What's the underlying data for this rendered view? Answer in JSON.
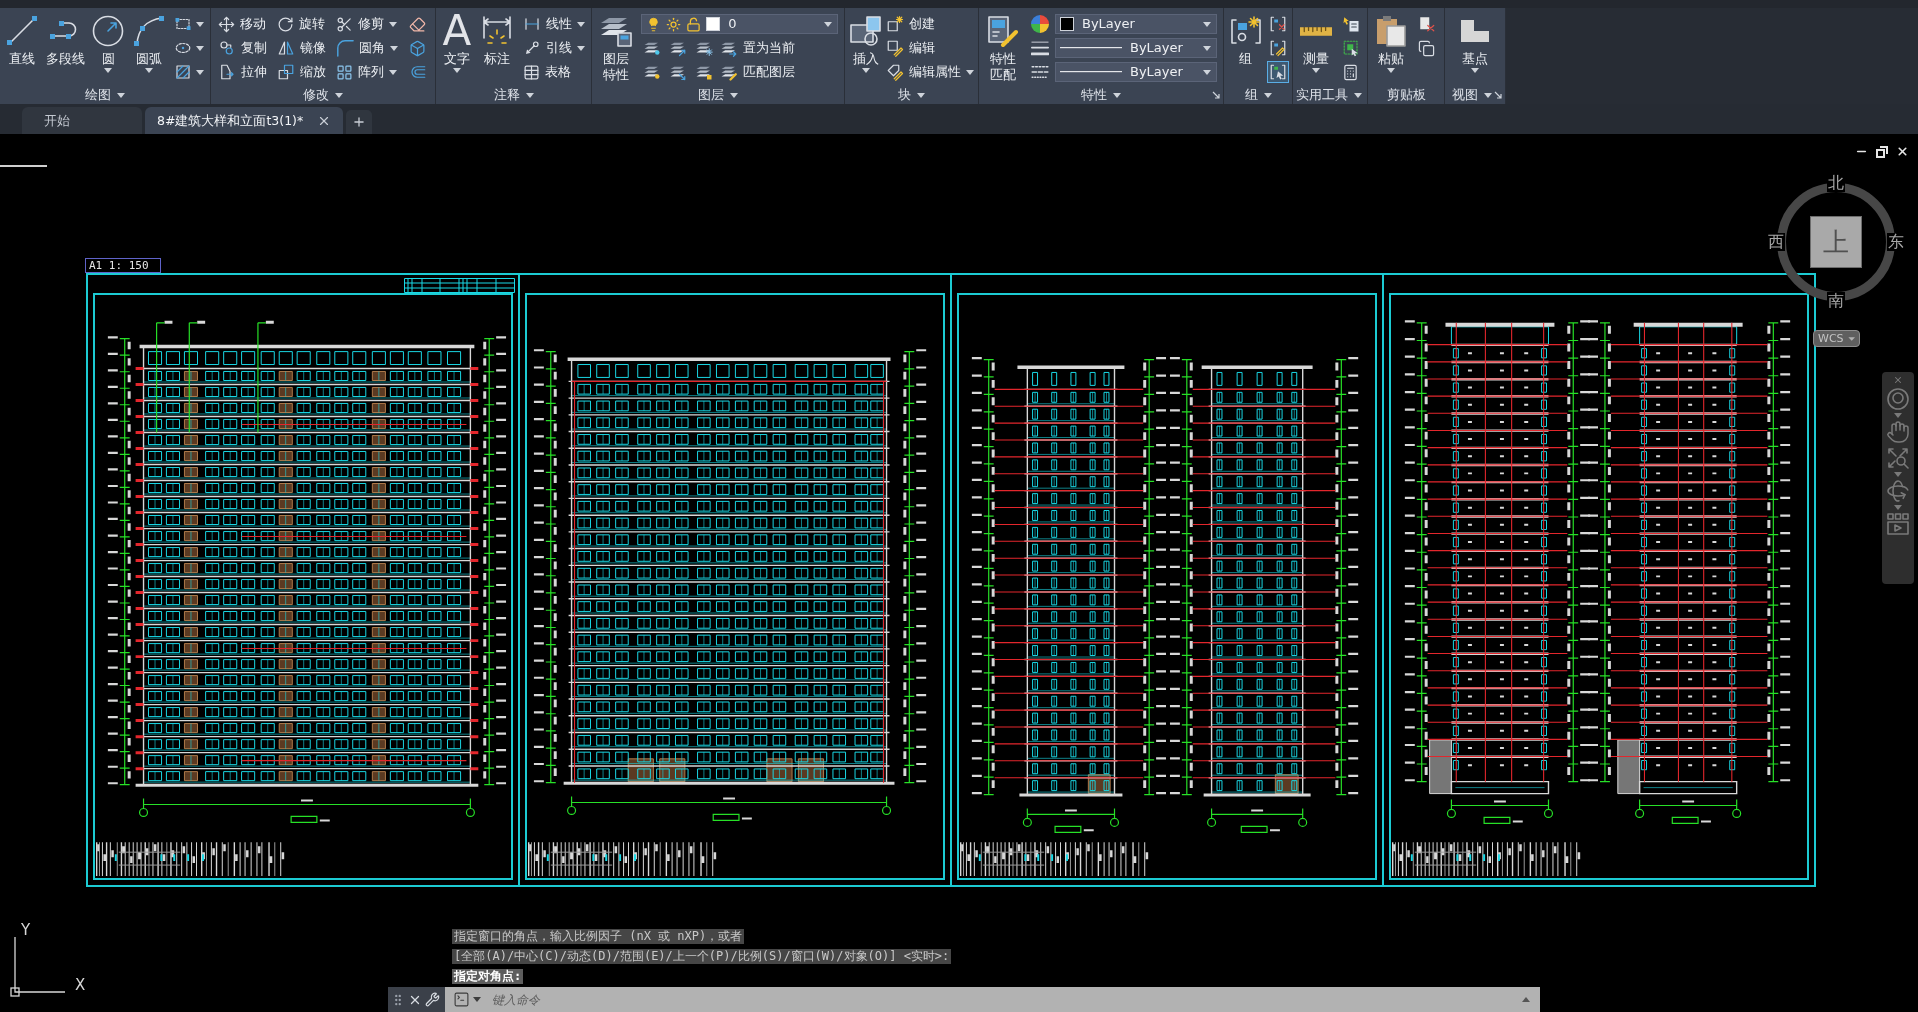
{
  "ribbon": {
    "panels": [
      {
        "title": "绘图",
        "menu": true,
        "launcher": false,
        "columns": [
          {
            "kind": "large",
            "label": [
              "直线"
            ],
            "dropdown": false
          },
          {
            "kind": "large",
            "label": [
              "多段线"
            ],
            "dropdown": false
          },
          {
            "kind": "large",
            "label": [
              "圆"
            ],
            "dropdown": true
          },
          {
            "kind": "large",
            "label": [
              "圆弧"
            ],
            "dropdown": true
          },
          {
            "kind": "stack",
            "rows": [
              [
                {
                  "kind": "icon",
                  "dropdown": true
                }
              ],
              [
                {
                  "kind": "icon",
                  "dropdown": true
                }
              ],
              [
                {
                  "kind": "icon",
                  "dropdown": true
                }
              ]
            ]
          }
        ]
      },
      {
        "title": "修改",
        "menu": true,
        "launcher": false,
        "columns": [
          {
            "kind": "stack",
            "rows": [
              [
                {
                  "kind": "tool",
                  "label": "移动",
                  "dropdown": false
                }
              ],
              [
                {
                  "kind": "tool",
                  "label": "复制",
                  "dropdown": false
                }
              ],
              [
                {
                  "kind": "tool",
                  "label": "拉伸",
                  "dropdown": false
                }
              ]
            ]
          },
          {
            "kind": "stack",
            "rows": [
              [
                {
                  "kind": "tool",
                  "label": "旋转",
                  "dropdown": false
                }
              ],
              [
                {
                  "kind": "tool",
                  "label": "镜像",
                  "dropdown": false
                }
              ],
              [
                {
                  "kind": "tool",
                  "label": "缩放",
                  "dropdown": false
                }
              ]
            ]
          },
          {
            "kind": "stack",
            "rows": [
              [
                {
                  "kind": "tool",
                  "label": "修剪",
                  "dropdown": true
                }
              ],
              [
                {
                  "kind": "tool",
                  "label": "圆角",
                  "dropdown": true
                }
              ],
              [
                {
                  "kind": "tool",
                  "label": "阵列",
                  "dropdown": true
                }
              ]
            ]
          },
          {
            "kind": "stack",
            "rows": [
              [
                {
                  "kind": "icon",
                  "dropdown": false
                }
              ],
              [
                {
                  "kind": "icon",
                  "dropdown": false
                }
              ],
              [
                {
                  "kind": "icon",
                  "dropdown": false
                }
              ]
            ]
          }
        ]
      },
      {
        "title": "注释",
        "menu": true,
        "launcher": false,
        "columns": [
          {
            "kind": "large",
            "label": [
              "文字"
            ],
            "glyph": "A",
            "dropdown": true
          },
          {
            "kind": "large",
            "label": [
              "标注"
            ],
            "dropdown": false
          },
          {
            "kind": "stack",
            "rows": [
              [
                {
                  "kind": "tool",
                  "label": "线性",
                  "dropdown": true
                }
              ],
              [
                {
                  "kind": "tool",
                  "label": "引线",
                  "dropdown": true
                }
              ],
              [
                {
                  "kind": "tool",
                  "label": "表格",
                  "dropdown": false
                }
              ]
            ]
          }
        ]
      },
      {
        "title": "图层",
        "menu": true,
        "launcher": false,
        "columns": [
          {
            "kind": "large",
            "label": [
              "图层",
              "特性"
            ],
            "dropdown": false
          },
          {
            "kind": "stack",
            "rows": [
              [
                {
                  "kind": "layer-combo",
                  "value": "0",
                  "layer_on": true,
                  "frozen": false,
                  "locked": false,
                  "color": "#ffffff"
                }
              ],
              [
                {
                  "kind": "icon",
                  "dropdown": false
                },
                {
                  "kind": "icon",
                  "dropdown": false
                },
                {
                  "kind": "icon",
                  "dropdown": false
                },
                {
                  "kind": "tool",
                  "label": "置为当前",
                  "dropdown": false
                }
              ],
              [
                {
                  "kind": "icon",
                  "dropdown": false
                },
                {
                  "kind": "icon",
                  "dropdown": false
                },
                {
                  "kind": "icon",
                  "dropdown": false
                },
                {
                  "kind": "tool",
                  "label": "匹配图层",
                  "dropdown": false
                }
              ]
            ]
          }
        ]
      },
      {
        "title": "块",
        "menu": true,
        "launcher": false,
        "columns": [
          {
            "kind": "large",
            "label": [
              "插入"
            ],
            "dropdown": true
          },
          {
            "kind": "stack",
            "rows": [
              [
                {
                  "kind": "tool",
                  "label": "创建",
                  "dropdown": false
                }
              ],
              [
                {
                  "kind": "tool",
                  "label": "编辑",
                  "dropdown": false
                }
              ],
              [
                {
                  "kind": "tool",
                  "label": "编辑属性",
                  "dropdown": true
                }
              ]
            ]
          }
        ]
      },
      {
        "title": "特性",
        "menu": true,
        "launcher": true,
        "columns": [
          {
            "kind": "large",
            "label": [
              "特性",
              "匹配"
            ],
            "dropdown": false
          },
          {
            "kind": "stack",
            "rows": [
              [
                {
                  "kind": "icon",
                  "dropdown": false
                },
                {
                  "kind": "color-combo",
                  "value": "ByLayer",
                  "color": "#000000"
                }
              ],
              [
                {
                  "kind": "icon",
                  "dropdown": false
                },
                {
                  "kind": "line-combo",
                  "value": "ByLayer"
                }
              ],
              [
                {
                  "kind": "icon",
                  "dropdown": false
                },
                {
                  "kind": "line-combo",
                  "value": "ByLayer"
                }
              ]
            ]
          }
        ]
      },
      {
        "title": "组",
        "menu": true,
        "launcher": false,
        "columns": [
          {
            "kind": "large",
            "label": [
              "组"
            ],
            "dropdown": false
          },
          {
            "kind": "stack",
            "rows": [
              [
                {
                  "kind": "icon",
                  "dropdown": false,
                  "on": false
                }
              ],
              [
                {
                  "kind": "icon",
                  "dropdown": false,
                  "on": false
                }
              ],
              [
                {
                  "kind": "icon",
                  "dropdown": false,
                  "on": true
                }
              ]
            ]
          }
        ]
      },
      {
        "title": "实用工具",
        "menu": true,
        "launcher": false,
        "columns": [
          {
            "kind": "large",
            "label": [
              "测量"
            ],
            "dropdown": true
          },
          {
            "kind": "stack",
            "rows": [
              [
                {
                  "kind": "icon",
                  "dropdown": false
                }
              ],
              [
                {
                  "kind": "icon",
                  "dropdown": false
                }
              ],
              [
                {
                  "kind": "icon",
                  "dropdown": false
                }
              ]
            ]
          }
        ]
      },
      {
        "title": "剪贴板",
        "menu": false,
        "launcher": false,
        "columns": [
          {
            "kind": "large",
            "label": [
              "粘贴"
            ],
            "dropdown": true
          },
          {
            "kind": "stack",
            "rows": [
              [
                {
                  "kind": "icon",
                  "dropdown": false
                }
              ],
              [
                {
                  "kind": "icon",
                  "dropdown": false
                }
              ]
            ]
          }
        ]
      },
      {
        "title": "视图",
        "menu": true,
        "launcher": true,
        "columns": [
          {
            "kind": "large",
            "label": [
              "基点"
            ],
            "dropdown": true
          }
        ]
      }
    ]
  },
  "file_tabs": [
    {
      "label": "开始",
      "selected": false,
      "closable": false
    },
    {
      "label": "8#建筑大样和立面t3(1)*",
      "selected": true,
      "closable": true
    }
  ],
  "viewport": {
    "sheet_label": "A1 1: 150",
    "sheets": [
      {
        "kind": "front-elevation",
        "header_table": true
      },
      {
        "kind": "rear-elevation",
        "header_table": false
      },
      {
        "kind": "side-elevations",
        "header_table": false
      },
      {
        "kind": "sections",
        "header_table": false
      }
    ]
  },
  "viewcube": {
    "face": "上",
    "north": "北",
    "west": "西",
    "east": "东",
    "south": "南",
    "ucs_menu": "WCS"
  },
  "ucs_icon": {
    "y_label": "Y",
    "x_label": "X"
  },
  "command_line": {
    "history": [
      "指定窗口的角点，输入比例因子 (nX 或 nXP)，或者",
      "[全部(A)/中心(C)/动态(D)/范围(E)/上一个(P)/比例(S)/窗口(W)/对象(O)] <实时>:"
    ],
    "prompt": "指定对角点:",
    "placeholder": "键入命令"
  }
}
